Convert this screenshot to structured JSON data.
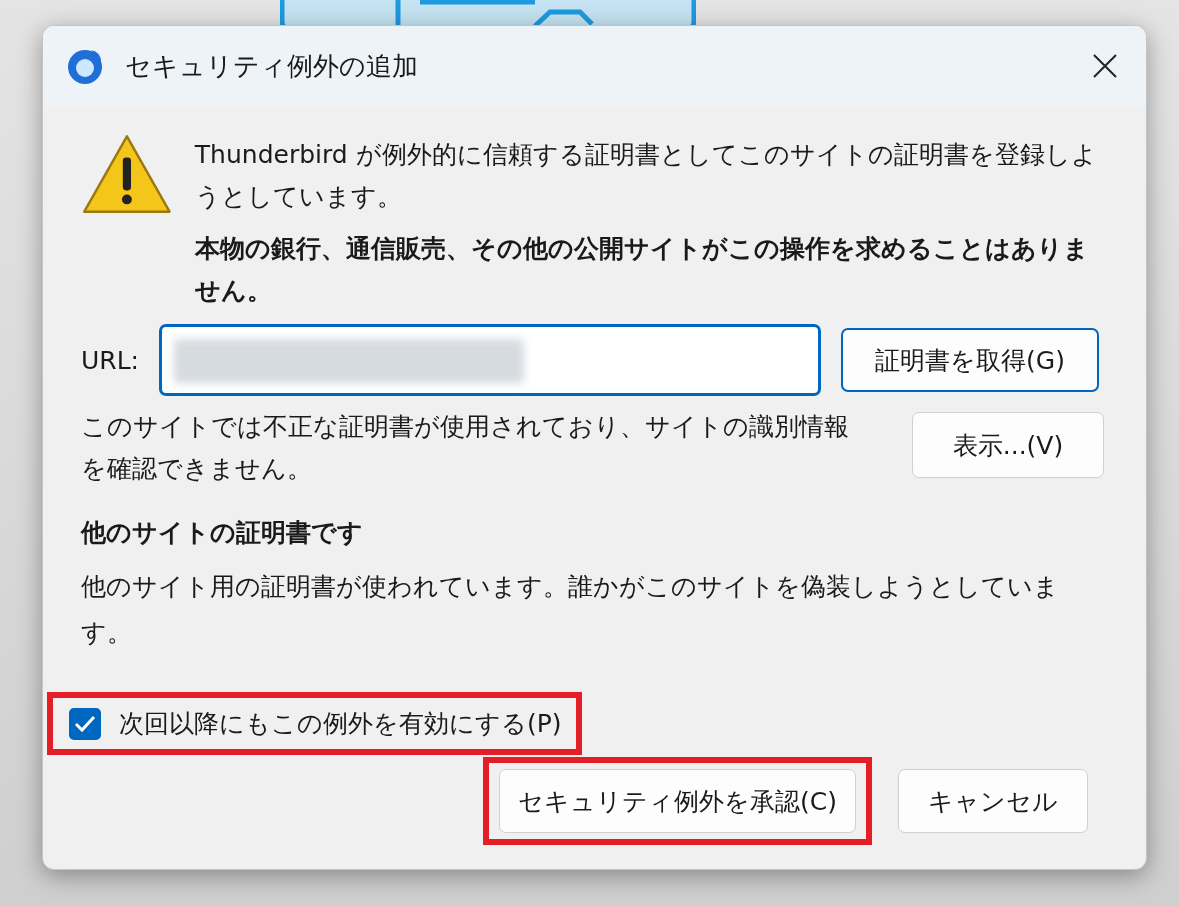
{
  "window": {
    "title": "セキュリティ例外の追加"
  },
  "warning": {
    "message": "Thunderbird が例外的に信頼する証明書としてこのサイトの証明書を登録しようとしています。",
    "emphasis": "本物の銀行、通信販売、その他の公開サイトがこの操作を求めることはありません。"
  },
  "url_field": {
    "label": "URL:",
    "redacted": true,
    "focused": true
  },
  "get_certificate_button": {
    "label": "証明書を取得(G)",
    "focused": true
  },
  "status_text": "このサイトでは不正な証明書が使用されており、サイトの識別情報を確認できません。",
  "view_button": {
    "label": "表示...(V)"
  },
  "problem": {
    "heading": "他のサイトの証明書です",
    "detail": "他のサイト用の証明書が使われています。誰かがこのサイトを偽装しようとしています。"
  },
  "permanent_checkbox": {
    "label": "次回以降にもこの例外を有効にする(P)",
    "checked": true,
    "highlighted": true
  },
  "buttons": [
    {
      "label": "セキュリティ例外を承認(C)",
      "highlighted": true
    },
    {
      "label": "キャンセル",
      "highlighted": false
    }
  ]
}
